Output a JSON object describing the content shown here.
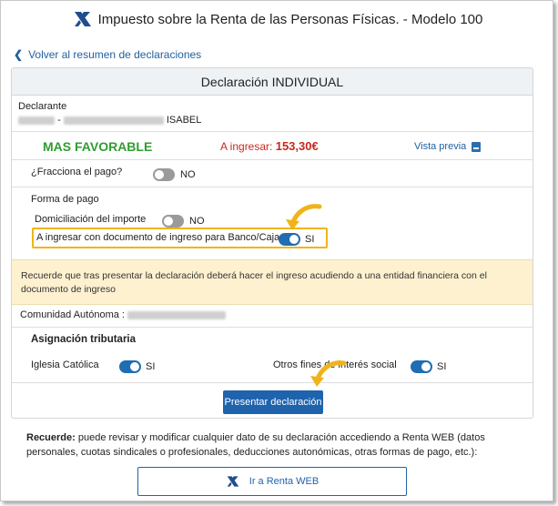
{
  "header": {
    "title": "Impuesto sobre la Renta de las Personas Físicas. - Modelo 100",
    "logo_icon": "aeat-logo-icon"
  },
  "nav": {
    "back_label": "Volver al resumen de declaraciones"
  },
  "card": {
    "title": "Declaración INDIVIDUAL",
    "declarante_label": "Declarante",
    "declarante_name_visible": "ISABEL",
    "declarante_separator": "-",
    "result_label": "MAS FAVORABLE",
    "ingresar_label": "A ingresar:",
    "ingresar_amount": "153,30€",
    "vista_previa_label": "Vista previa",
    "fracciona": {
      "label": "¿Fracciona el pago?",
      "value": "NO",
      "on": false
    },
    "forma_pago": {
      "label": "Forma de pago",
      "domiciliacion": {
        "label": "Domiciliación del importe",
        "value": "NO",
        "on": false
      },
      "documento": {
        "label": "A ingresar con documento de ingreso para Banco/Caja",
        "value": "SI",
        "on": true
      }
    },
    "info_text": "Recuerde que tras presentar la declaración deberá hacer el ingreso acudiendo a una entidad financiera con el documento de ingreso",
    "comunidad_label": "Comunidad Autónoma :",
    "asignacion": {
      "title": "Asignación tributaria",
      "iglesia": {
        "label": "Iglesia Católica",
        "value": "SI",
        "on": true
      },
      "otros": {
        "label": "Otros fines de interés social",
        "value": "SI",
        "on": true
      }
    },
    "present_button": "Presentar declaración"
  },
  "footer": {
    "recuerde_bold": "Recuerde:",
    "recuerde_text": " puede revisar y modificar cualquier dato de su declaración accediendo a Renta WEB (datos personales, cuotas sindicales o profesionales, deducciones autonómicas, otras formas de pago, etc.):",
    "renta_button": "Ir a Renta WEB"
  },
  "colors": {
    "accent": "#1f63ad",
    "favorable": "#2f9e2f",
    "amount": "#c8291c",
    "highlight": "#f0b41a",
    "info_bg": "#fdf1cf"
  }
}
